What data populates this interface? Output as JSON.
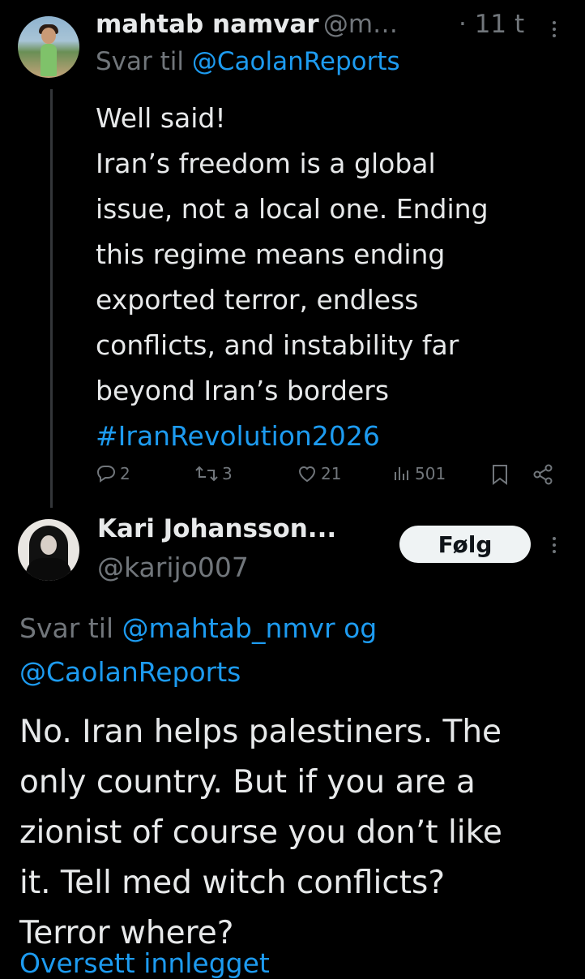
{
  "tweet1": {
    "author_name": "mahtab namvar",
    "handle": "@m…",
    "time": "· 11 t",
    "reply_prefix": "Svar til",
    "reply_to": "@CaolanReports",
    "lines": [
      "Well said!",
      "Iran’s freedom is a global",
      "issue, not a local one. Ending",
      "this regime means ending",
      "exported terror, endless",
      "conflicts, and instability far",
      "beyond Iran’s borders"
    ],
    "hashtag": "#IranRevolution2026",
    "stats": {
      "replies": "2",
      "retweets": "3",
      "likes": "21",
      "views": "501"
    }
  },
  "tweet2": {
    "author_name": "Kari Johansson...",
    "handle": "@karijo007",
    "follow_label": "Følg",
    "reply_prefix": "Svar til",
    "reply_to_1": "@mahtab_nmvr",
    "reply_and": "og",
    "reply_to_2": "@CaolanReports",
    "lines": [
      "No. Iran helps palestiners. The",
      "only country. But if you are a",
      "zionist of course you don’t like",
      "it. Tell med witch conflicts?",
      "Terror where?"
    ],
    "truncated_link": "Oversett innlegget"
  },
  "colors": {
    "background": "#000000",
    "text": "#e7e9ea",
    "muted": "#71767b",
    "link": "#1d9bf0",
    "button_bg": "#eff3f4"
  }
}
